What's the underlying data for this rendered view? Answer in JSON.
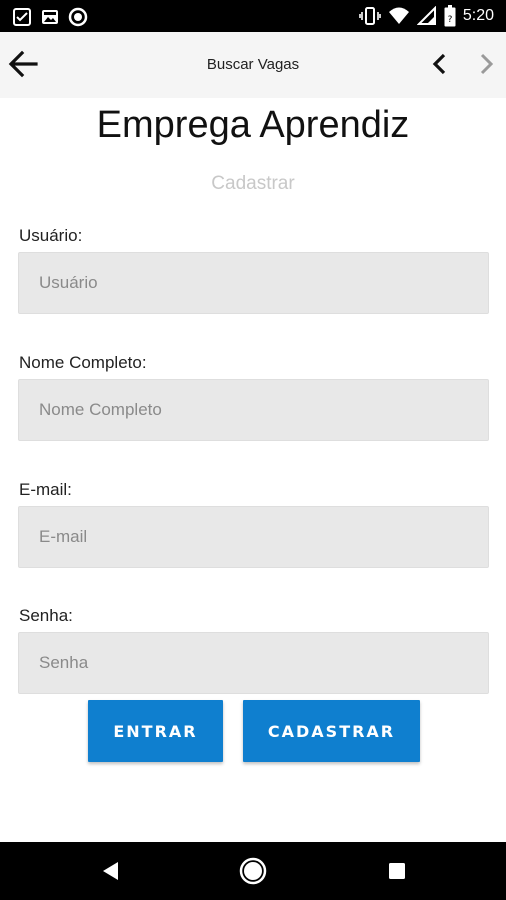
{
  "status_bar": {
    "time": "5:20",
    "left_icons": [
      "checklist-icon",
      "image-icon",
      "circle-icon"
    ],
    "right_icons": [
      "vibrate-icon",
      "wifi-icon",
      "signal-icon",
      "battery-icon"
    ]
  },
  "app_bar": {
    "title": "Buscar Vagas",
    "back_icon": "arrow-left-icon",
    "prev_icon": "chevron-left-icon",
    "next_icon": "chevron-right-icon"
  },
  "page": {
    "title": "Emprega Aprendiz",
    "subtitle": "Cadastrar"
  },
  "form": {
    "fields": [
      {
        "label": "Usuário:",
        "placeholder": "Usuário",
        "value": ""
      },
      {
        "label": "Nome Completo:",
        "placeholder": "Nome Completo",
        "value": ""
      },
      {
        "label": "E-mail:",
        "placeholder": "E-mail",
        "value": ""
      },
      {
        "label": "Senha:",
        "placeholder": "Senha",
        "value": ""
      }
    ],
    "buttons": {
      "login": "ENTRAR",
      "register": "CADASTRAR"
    }
  },
  "colors": {
    "accent": "#0f7fcf",
    "field_bg": "#e8e8e8",
    "app_bar_bg": "#f5f5f5",
    "subtitle": "#c8c8c8"
  },
  "system_nav": {
    "icons": [
      "back-triangle-icon",
      "home-circle-icon",
      "recents-square-icon"
    ]
  }
}
